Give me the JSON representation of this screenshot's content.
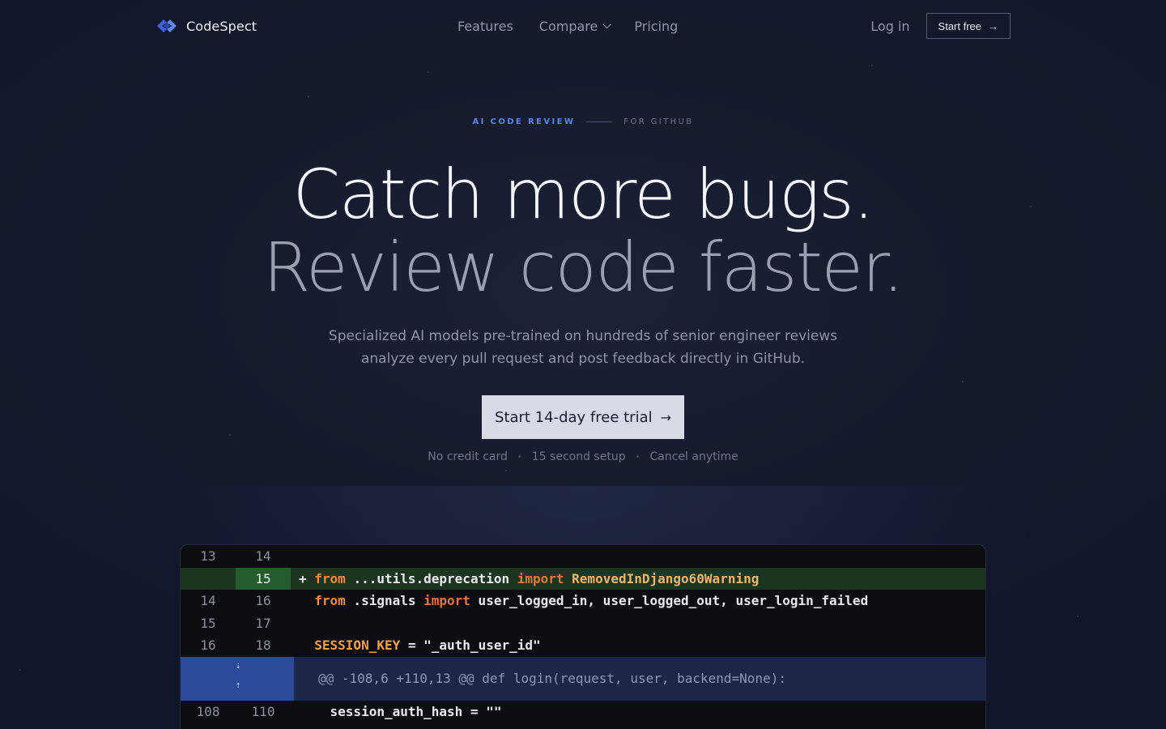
{
  "nav": {
    "brand": "CodeSpect",
    "links": [
      {
        "label": "Features"
      },
      {
        "label": "Compare"
      },
      {
        "label": "Pricing"
      }
    ],
    "login": "Log in",
    "start": "Start free"
  },
  "hero": {
    "eyebrow_primary": "AI CODE REVIEW",
    "eyebrow_secondary": "FOR GITHUB",
    "headline_1": "Catch more bugs.",
    "headline_2": "Review code faster.",
    "sub_1": "Specialized AI models pre-trained on hundreds of senior engineer reviews",
    "sub_2": "analyze every pull request and post feedback directly in GitHub.",
    "cta": "Start 14-day free trial",
    "perks": [
      "No credit card",
      "15 second setup",
      "Cancel anytime"
    ]
  },
  "code": {
    "rows": [
      {
        "old": "13",
        "new": "14"
      },
      {
        "old": "",
        "new": "15",
        "added": true,
        "marker": "+",
        "kw1": "from",
        "mod": " ...utils.deprecation ",
        "kw2": "import",
        "cls": " RemovedInDjango60Warning"
      },
      {
        "old": "14",
        "new": "16",
        "kw1": "from",
        "mod": " .signals ",
        "kw2": "import",
        "rest": " user_logged_in, user_logged_out, user_login_failed"
      },
      {
        "old": "15",
        "new": "17"
      },
      {
        "old": "16",
        "new": "18",
        "var": "SESSION_KEY",
        "rest": " = \"_auth_user_id\""
      }
    ],
    "hunk": "@@ -108,6 +110,13 @@ def login(request, user, backend=None):",
    "last_row": {
      "old": "108",
      "new": "110",
      "text": "    session_auth_hash = \"\""
    }
  },
  "colors": {
    "accent": "#5b86e8",
    "background": "#13172a",
    "cta_bg": "#d7dbe6",
    "added_line": "#1c3520",
    "hunk_bg": "#1c2647"
  }
}
